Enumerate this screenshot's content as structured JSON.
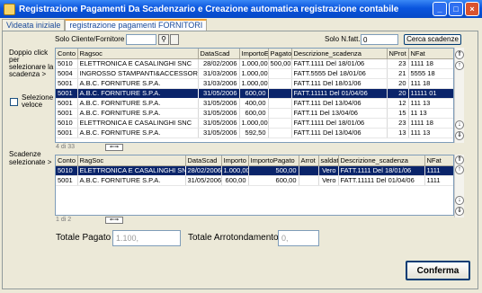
{
  "window": {
    "title": "Registrazione Pagamenti Da Scadenzario e Creazione automatica registrazione contabile"
  },
  "tabs": [
    {
      "label": "Videata iniziale"
    },
    {
      "label": "registrazione pagamenti FORNITORI"
    }
  ],
  "filter": {
    "solo_cliente_label": "Solo Cliente/Fornitore",
    "solo_nfatt_label": "Solo N.fatt.",
    "solo_nfatt_value": "0",
    "cerca_label": "Cerca scadenze"
  },
  "side": {
    "doppio_click": "Doppio click per selezionare la scadenza >",
    "selezione_veloce": "Selezione veloce",
    "scadenze_selezionate": "Scadenze selezionate >"
  },
  "grid1": {
    "columns": [
      "Conto",
      "Ragsoc",
      "DataScad",
      "ImportoE",
      "Pagato",
      "Descrizione_scadenza",
      "NProt",
      "NFat"
    ],
    "rows": [
      [
        "5010",
        "ELETTRONICA E CASALINGHI SNC",
        "28/02/2006",
        "1.000,00",
        "500,00",
        "FATT.1111 Del 18/01/06",
        "23",
        "1111 18"
      ],
      [
        "5004",
        "INGROSSO STAMPANTI&ACCESSORI S.R.L",
        "31/03/2006",
        "1.000,00",
        "",
        "FATT.5555 Del 18/01/06",
        "21",
        "5555 18"
      ],
      [
        "5001",
        "A.B.C. FORNITURE S.P.A.",
        "31/03/2006",
        "1.000,00",
        "",
        "FATT.111 Del 18/01/06",
        "20",
        "111 18"
      ],
      [
        "5001",
        "A.B.C. FORNITURE S.P.A.",
        "31/05/2006",
        "600,00",
        "",
        "FATT.11111 Del 01/04/06",
        "20",
        "11111 01"
      ],
      [
        "5001",
        "A.B.C. FORNITURE S.P.A.",
        "31/05/2006",
        "400,00",
        "",
        "FATT.111 Del 13/04/06",
        "12",
        "111 13"
      ],
      [
        "5001",
        "A.B.C. FORNITURE S.P.A.",
        "31/05/2006",
        "600,00",
        "",
        "FATT.11 Del 13/04/06",
        "15",
        "11 13"
      ],
      [
        "5010",
        "ELETTRONICA E CASALINGHI SNC",
        "31/05/2006",
        "1.000,00",
        "",
        "FATT.1111 Del 18/01/06",
        "23",
        "1111 18"
      ],
      [
        "5001",
        "A.B.C. FORNITURE S.P.A.",
        "31/05/2006",
        "592,50",
        "",
        "FATT.111 Del 13/04/06",
        "13",
        "111 13"
      ]
    ],
    "selected_index": 3,
    "status": "4 di 33"
  },
  "grid2": {
    "columns": [
      "Conto",
      "RagSoc",
      "DataScad",
      "Importo",
      "ImportoPagato",
      "Arrot",
      "saldata",
      "Descrizione_scadenza",
      "NFat"
    ],
    "rows": [
      [
        "5010",
        "ELETTRONICA E CASALINGHI SNC",
        "28/02/2006",
        "1.000,00",
        "500,00",
        "",
        "Vero",
        "FATT.1111 Del 18/01/06",
        "1111"
      ],
      [
        "5001",
        "A.B.C. FORNITURE S.P.A.",
        "31/05/2006",
        "600,00",
        "600,00",
        "",
        "Vero",
        "FATT.11111 Del 01/04/06",
        "1111"
      ]
    ],
    "selected_index": 0,
    "status": "1 di 2"
  },
  "totals": {
    "pagato_label": "Totale Pagato",
    "pagato_value": "1.100,",
    "arrotondamento_label": "Totale Arrotondamento",
    "arrotondamento_value": "0,"
  },
  "confirm_label": "Conferma"
}
